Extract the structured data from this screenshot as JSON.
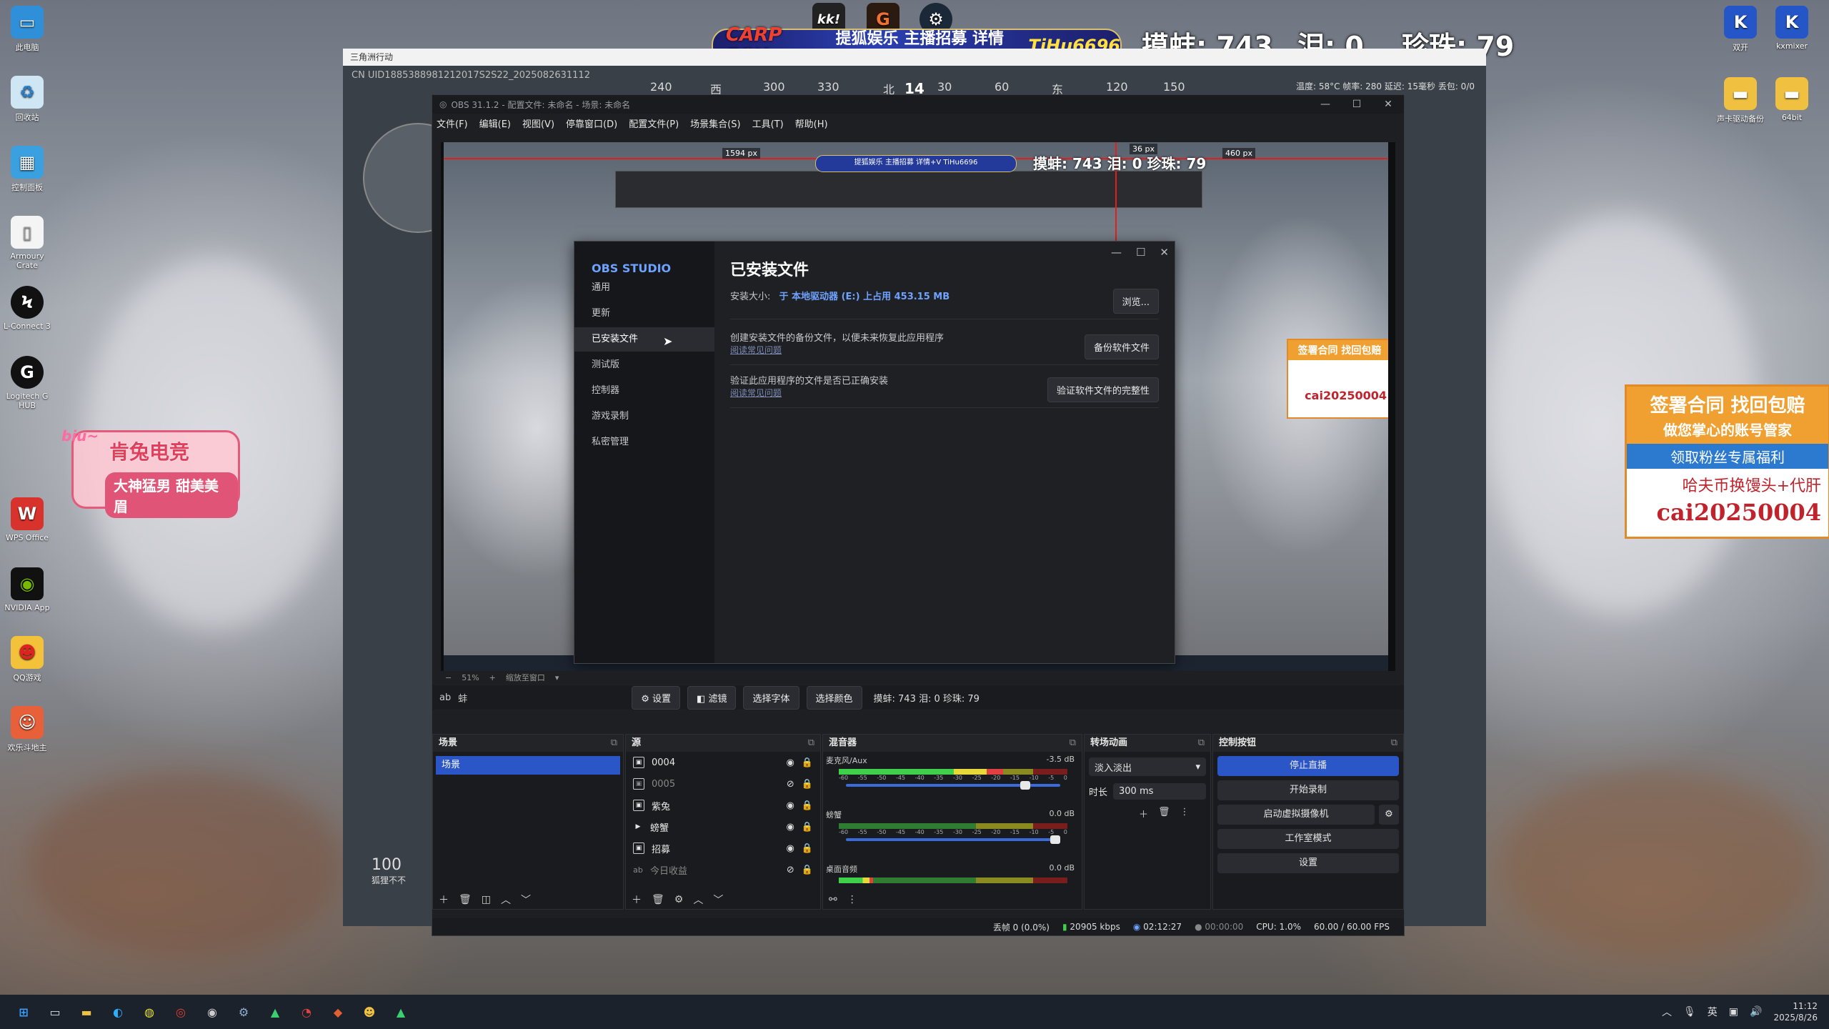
{
  "desktop": {
    "left_icons": [
      {
        "label": "此电脑",
        "icon": "monitor-icon"
      },
      {
        "label": "回收站",
        "icon": "recycle-bin-icon"
      },
      {
        "label": "控制面板",
        "icon": "control-panel-icon"
      },
      {
        "label": "Armoury Crate",
        "icon": "file-icon"
      },
      {
        "label": "L-Connect 3",
        "icon": "lconnect-icon"
      },
      {
        "label": "Logitech G HUB",
        "icon": "logitech-icon"
      },
      {
        "label": "WPS Office",
        "icon": "wps-icon"
      },
      {
        "label": "NVIDIA App",
        "icon": "nvidia-icon"
      },
      {
        "label": "QQ游戏",
        "icon": "qq-game-icon"
      },
      {
        "label": "欢乐斗地主",
        "icon": "doudizhu-icon"
      }
    ],
    "right_icons": [
      {
        "label": "双开",
        "icon": "kx-icon"
      },
      {
        "label": "kxmixer",
        "icon": "kx-icon"
      },
      {
        "label": "声卡驱动备份",
        "icon": "folder-icon"
      },
      {
        "label": "64bit",
        "icon": "folder-icon"
      }
    ],
    "top_icons": [
      {
        "label": "kk!",
        "icon": "kk-icon"
      },
      {
        "label": "G",
        "icon": "g-icon"
      },
      {
        "label": "Steam",
        "icon": "steam-icon"
      }
    ]
  },
  "overlay": {
    "banner_brand": "CARP FOX",
    "banner_text": "提狐娱乐 主播招募 详情+V",
    "banner_code": "TiHu6696",
    "counter_shrimp": "摸蚌: 743",
    "counter_tear": "泪: 0",
    "counter_pearl": "珍珠: 79",
    "promo_line1": "签署合同 找回包赔",
    "promo_line2": "做您掌心的账号管家",
    "promo_line3": "领取粉丝专属福利",
    "promo_line4": "哈夫币换馒头+代肝",
    "promo_line5": "cai20250004",
    "badge_biu": "biu~",
    "badge_title": "肯兔电竞",
    "badge_sub": "大神猛男 甜美美眉"
  },
  "game": {
    "title": "三角洲行动",
    "id_line": "CN UID1885388981212017S2S22_2025082631112",
    "compass": [
      "240",
      "西",
      "300",
      "330",
      "北",
      "14",
      "30",
      "60",
      "东",
      "120",
      "150"
    ],
    "hud": "温度: 58°C 帧率: 280 延迟: 15毫秒 丢包: 0/0",
    "health": "100",
    "health_name": "狐狸不不"
  },
  "obs": {
    "title": "OBS 31.1.2 - 配置文件: 未命名 - 场景: 未命名",
    "menu": [
      "文件(F)",
      "编辑(E)",
      "视图(V)",
      "停靠窗口(D)",
      "配置文件(P)",
      "场景集合(S)",
      "工具(T)",
      "帮助(H)"
    ],
    "preview": {
      "banner": "提狐娱乐 主播招募 详情+V TiHu6696",
      "counter": "摸蚌: 743 泪: 0 珍珠: 79",
      "px_left": "1594 px",
      "px_mid": "36 px",
      "px_right": "460 px",
      "promo": "签署合同 找回包赔",
      "promo_code": "cai20250004"
    },
    "settings": {
      "brand": "OBS STUDIO",
      "nav": [
        "通用",
        "更新",
        "已安装文件",
        "测试版",
        "控制器",
        "游戏录制",
        "私密管理"
      ],
      "active_nav": "已安装文件",
      "heading": "已安装文件",
      "size_label": "安装大小:",
      "size_value": "于 本地驱动器 (E:) 上占用 453.15 MB",
      "browse": "浏览...",
      "backup_label": "创建安装文件的备份文件，以便未来恢复此应用程序",
      "backup_link": "阅读常见问题",
      "backup_btn": "备份软件文件",
      "verify_label": "验证此应用程序的文件是否已正确安装",
      "verify_link": "阅读常见问题",
      "verify_btn": "验证软件文件的完整性"
    },
    "zoom": "51%",
    "zoom_mode": "缩放至窗口",
    "context": {
      "source": "蚌",
      "settings_btn": "设置",
      "filters_btn": "滤镜",
      "font_btn": "选择字体",
      "color_btn": "选择颜色",
      "info": "摸蚌: 743 泪: 0 珍珠: 79"
    },
    "scenes": {
      "title": "场景",
      "items": [
        "场景"
      ]
    },
    "sources": {
      "title": "源",
      "items": [
        {
          "name": "0004",
          "type": "image-icon",
          "visible": true
        },
        {
          "name": "0005",
          "type": "image-icon",
          "visible": false
        },
        {
          "name": "紫兔",
          "type": "image-icon",
          "visible": true
        },
        {
          "name": "螃蟹",
          "type": "media-icon",
          "visible": true
        },
        {
          "name": "招募",
          "type": "image-icon",
          "visible": true
        },
        {
          "name": "今日收益",
          "type": "text-icon",
          "visible": false
        }
      ]
    },
    "mixer": {
      "title": "混音器",
      "channels": [
        {
          "name": "麦克风/Aux",
          "db": "-3.5 dB",
          "level": 0.72,
          "volume": 0.86
        },
        {
          "name": "螃蟹",
          "db": "0.0 dB",
          "level": 0.0,
          "volume": 1.0
        },
        {
          "name": "桌面音频",
          "db": "0.0 dB",
          "level": 0.15,
          "volume": 1.0
        }
      ],
      "ticks": [
        "-60",
        "-55",
        "-50",
        "-45",
        "-40",
        "-35",
        "-30",
        "-25",
        "-20",
        "-15",
        "-10",
        "-5",
        "0"
      ]
    },
    "transitions": {
      "title": "转场动画",
      "selected": "淡入淡出",
      "duration_label": "时长",
      "duration": "300 ms"
    },
    "controls": {
      "title": "控制按钮",
      "stop_stream": "停止直播",
      "start_record": "开始录制",
      "virtual_cam": "启动虚拟摄像机",
      "studio_mode": "工作室模式",
      "settings": "设置"
    },
    "status": {
      "dropped": "丢帧 0 (0.0%)",
      "bitrate": "20905 kbps",
      "live_time": "02:12:27",
      "rec_time": "00:00:00",
      "cpu": "CPU: 1.0%",
      "fps": "60.00 / 60.00 FPS"
    }
  },
  "taskbar": {
    "tray_lang": "英",
    "time": "11:12",
    "date": "2025/8/26"
  },
  "colors": {
    "obs_accent": "#2b56c8",
    "settings_accent": "#6ea2ff",
    "overlay_red": "#e02020"
  }
}
